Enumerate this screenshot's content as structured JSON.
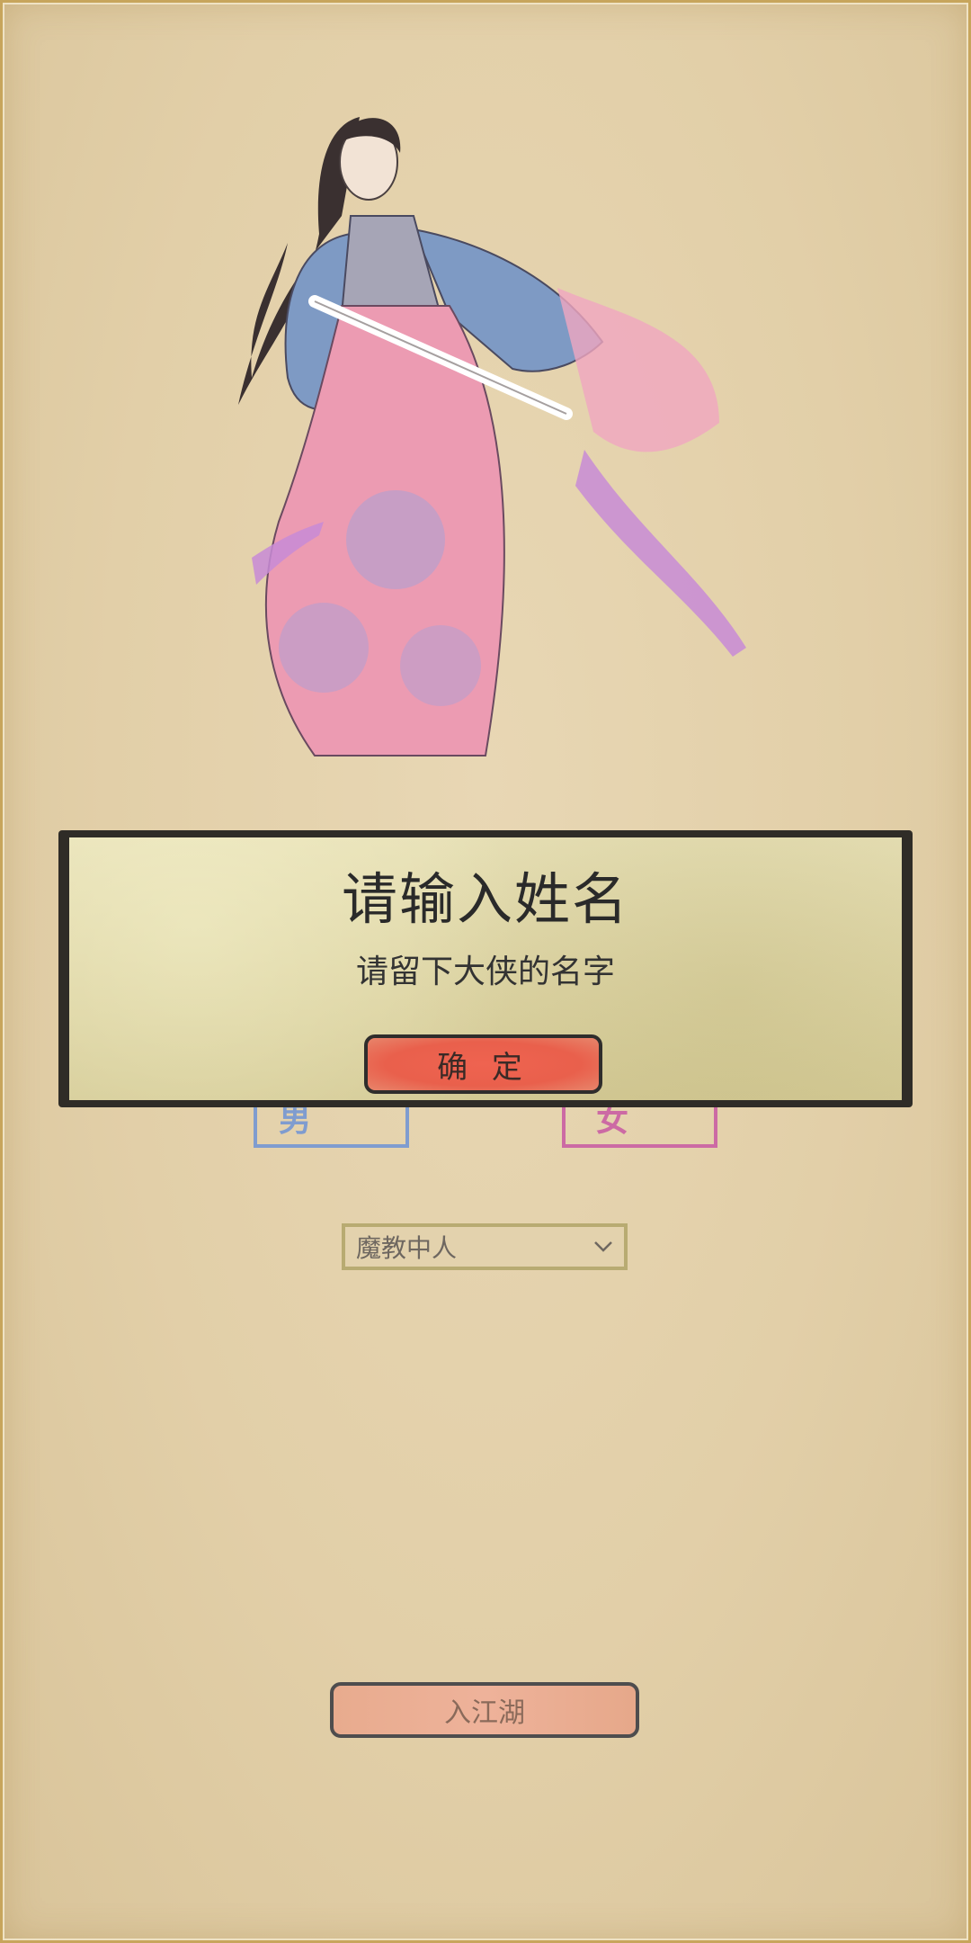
{
  "dialog": {
    "title": "请输入姓名",
    "message": "请留下大侠的名字",
    "confirm_label": "确 定"
  },
  "gender_buttons": [
    {
      "label": "男",
      "color": "#7f9ccf"
    },
    {
      "label": "女",
      "color": "#cc6aa4"
    }
  ],
  "faction_select": {
    "selected": "魔教中人"
  },
  "enter_button": {
    "label": "入江湖"
  },
  "colors": {
    "background": "#e2cfa8",
    "accent_red": "#e9604c",
    "dialog_bg": "#ddd4a4"
  },
  "icons": {
    "character": "martial-heroine-illustration",
    "dropdown": "chevron-down-icon"
  }
}
